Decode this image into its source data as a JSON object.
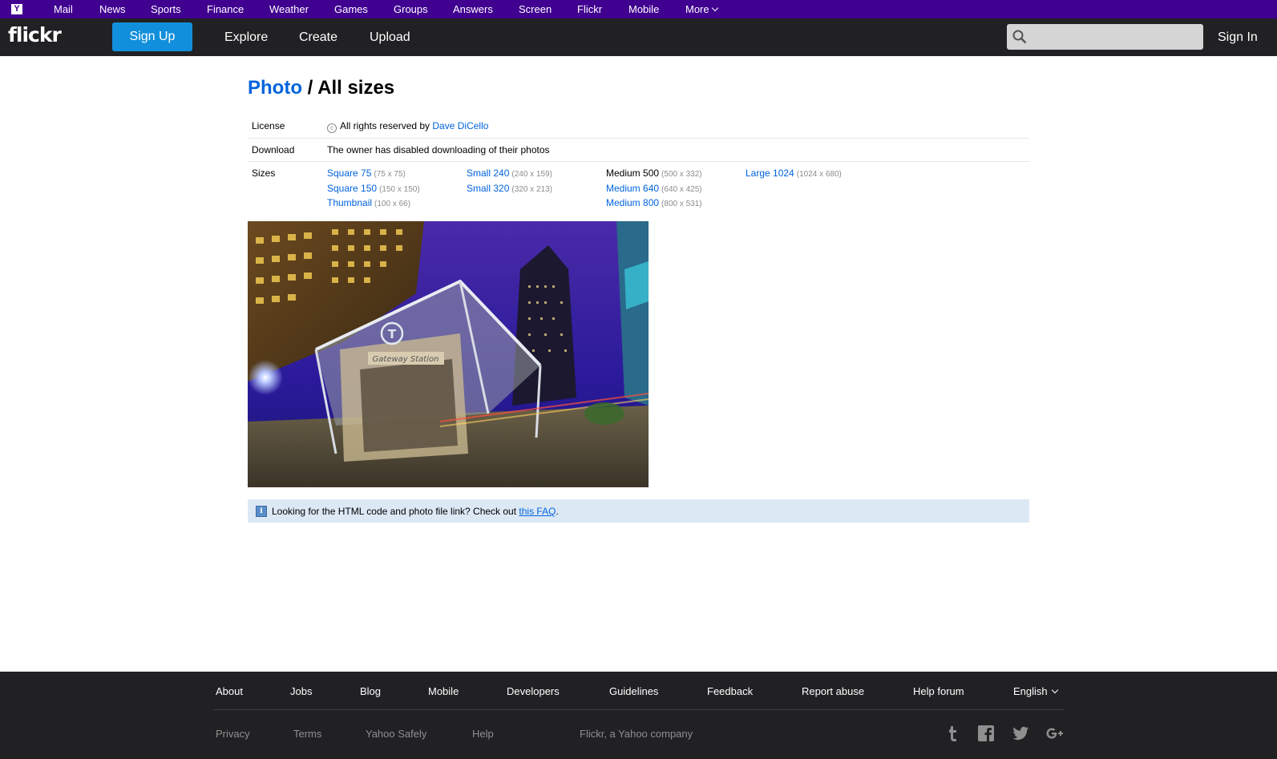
{
  "yahoo_bar": {
    "logo": "Y",
    "items": [
      "Mail",
      "News",
      "Sports",
      "Finance",
      "Weather",
      "Games",
      "Groups",
      "Answers",
      "Screen",
      "Flickr",
      "Mobile",
      "More"
    ]
  },
  "header": {
    "logo": "flickr",
    "signup": "Sign Up",
    "nav": [
      "Explore",
      "Create",
      "Upload"
    ],
    "search_placeholder": "",
    "signin": "Sign In"
  },
  "page": {
    "crumb": "Photo",
    "sep": " / ",
    "title": "All sizes"
  },
  "info": {
    "license_label": "License",
    "license_text": "All rights reserved by",
    "owner": "Dave DiCello",
    "download_label": "Download",
    "download_text": "The owner has disabled downloading of their photos",
    "sizes_label": "Sizes"
  },
  "sizes": {
    "columns": [
      [
        {
          "name": "Square 75",
          "dim": "(75 x 75)"
        },
        {
          "name": "Square 150",
          "dim": "(150 x 150)"
        },
        {
          "name": "Thumbnail",
          "dim": "(100 x 66)"
        }
      ],
      [
        {
          "name": "Small 240",
          "dim": "(240 x 159)"
        },
        {
          "name": "Small 320",
          "dim": "(320 x 213)"
        }
      ],
      [
        {
          "name": "Medium 500",
          "dim": "(500 x 332)",
          "current": true
        },
        {
          "name": "Medium 640",
          "dim": "(640 x 425)"
        },
        {
          "name": "Medium 800",
          "dim": "(800 x 531)"
        }
      ],
      [
        {
          "name": "Large 1024",
          "dim": "(1024 x 680)"
        }
      ]
    ]
  },
  "photo": {
    "sign_text": "Gateway Station"
  },
  "faq": {
    "text": "Looking for the HTML code and photo file link? Check out",
    "link": "this FAQ",
    "end": "."
  },
  "footer": {
    "links": [
      "About",
      "Jobs",
      "Blog",
      "Mobile",
      "Developers",
      "Guidelines",
      "Feedback",
      "Report abuse",
      "Help forum",
      "English"
    ],
    "links2": [
      "Privacy",
      "Terms",
      "Yahoo Safely",
      "Help"
    ],
    "company": "Flickr, a Yahoo company",
    "social": [
      "tumblr-icon",
      "facebook-icon",
      "twitter-icon",
      "google-plus-icon"
    ]
  },
  "colors": {
    "yahoo_purple": "#400090",
    "header_bg": "#212124",
    "signup_blue": "#128fdc",
    "link_blue": "#0063dc",
    "faq_bg": "#dde8f5"
  }
}
